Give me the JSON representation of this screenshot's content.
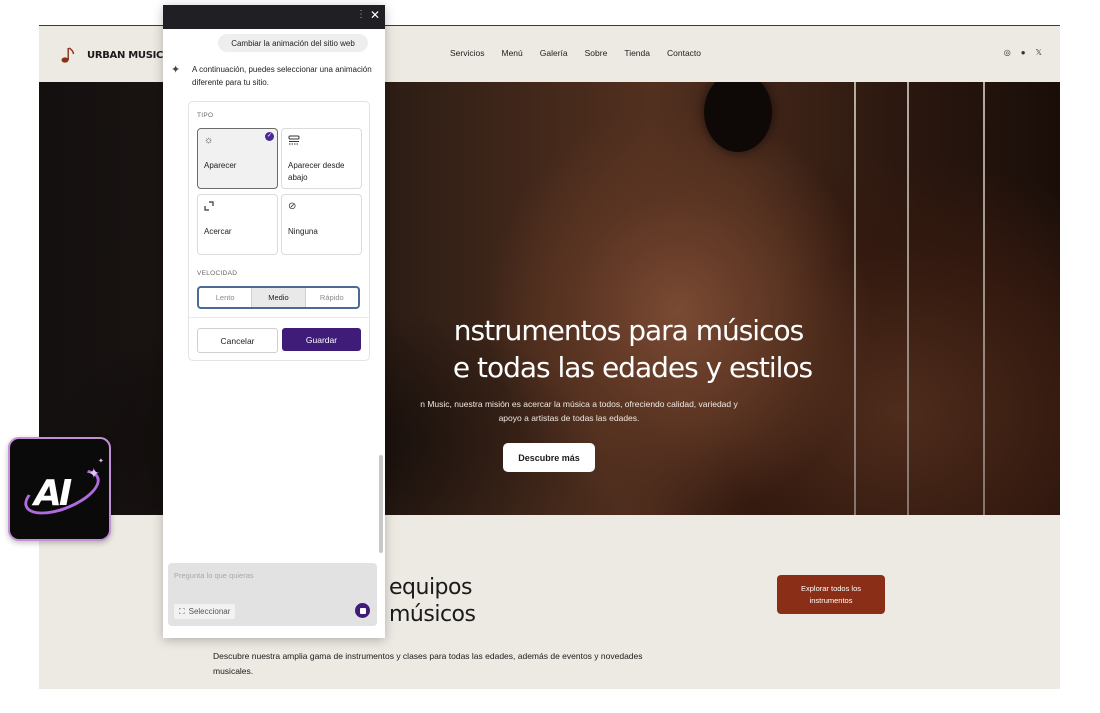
{
  "site": {
    "logo_text": "URBAN MUSIC",
    "nav": [
      "Servicios",
      "Menú",
      "Galería",
      "Sobre",
      "Tienda",
      "Contacto"
    ],
    "hero": {
      "title_line1": "nstrumentos para músicos",
      "title_line2": "e todas las edades y estilos",
      "subtitle_line1": "n Music, nuestra misión es acercar la música a todos, ofreciendo calidad, variedad y",
      "subtitle_line2": "apoyo a artistas de todas las edades.",
      "cta": "Descubre más"
    },
    "section": {
      "title_line1": "equipos",
      "title_line2": "músicos",
      "explore_line1": "Explorar todos los",
      "explore_line2": "instrumentos",
      "desc_line1": "Descubre nuestra amplia gama de instrumentos y clases para todas las edades, además de eventos y novedades",
      "desc_line2": "musicales."
    }
  },
  "panel": {
    "user_message": "Cambiar la animación del sitio web",
    "ai_message": "A continuación, puedes seleccionar una animación diferente para tu sitio.",
    "type_label": "TIPO",
    "options": [
      {
        "label": "Aparecer",
        "icon": "sun-icon",
        "selected": true
      },
      {
        "label": "Aparecer desde abajo",
        "icon": "slide-up-icon",
        "selected": false
      },
      {
        "label": "Acercar",
        "icon": "zoom-icon",
        "selected": false
      },
      {
        "label": "Ninguna",
        "icon": "none-icon",
        "selected": false
      }
    ],
    "speed_label": "VELOCIDAD",
    "speeds": [
      "Lento",
      "Medio",
      "Rápido"
    ],
    "speed_selected": "Medio",
    "cancel": "Cancelar",
    "save": "Guardar",
    "input_placeholder": "Pregunta lo que quieras",
    "select_label": "Seleccionar"
  },
  "app_badge": {
    "text": "AI",
    "accent": "#b06be0"
  },
  "colors": {
    "primary": "#3f1c78",
    "explore": "#8a2e17",
    "background": "#ede9e3"
  }
}
